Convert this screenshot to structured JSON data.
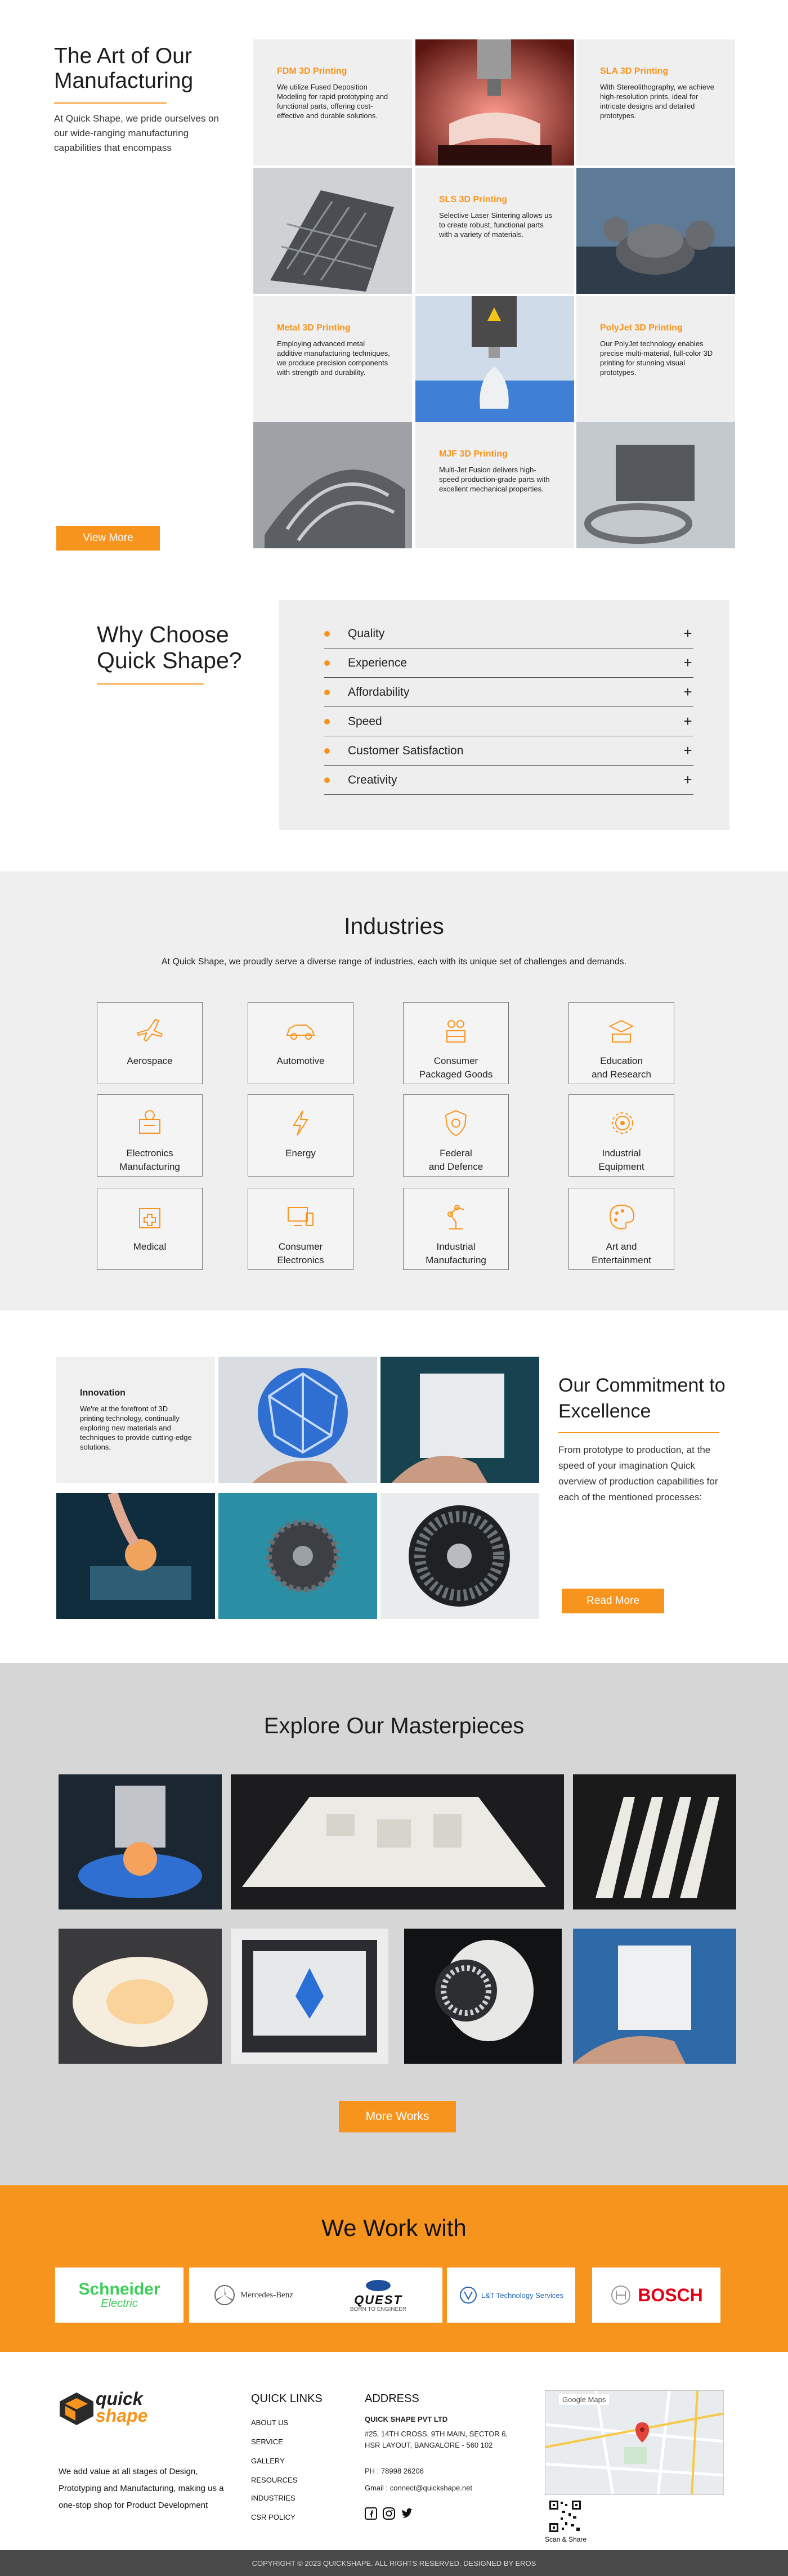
{
  "manufacturing": {
    "title": "The Art of Our Manufacturing",
    "description": "At Quick Shape, we pride ourselves on our wide-ranging manufacturing capabilities that encompass",
    "button": "View More",
    "tiles": [
      {
        "heading": "FDM 3D Printing",
        "text": "We utilize Fused Deposition Modeling for rapid prototyping and functional parts, offering cost-effective and durable solutions."
      },
      {
        "heading": "SLA 3D Printing",
        "text": "With Stereolithography, we achieve high-resolution prints, ideal for intricate designs and detailed prototypes."
      },
      {
        "heading": "SLS 3D Printing",
        "text": "Selective Laser Sintering allows us to create robust, functional parts with a variety of materials."
      },
      {
        "heading": "Metal 3D Printing",
        "text": "Employing advanced metal additive manufacturing techniques, we produce precision components with strength and durability."
      },
      {
        "heading": "PolyJet 3D Printing",
        "text": "Our PolyJet technology enables precise multi-material, full-color 3D printing for stunning visual prototypes."
      },
      {
        "heading": "MJF 3D Printing",
        "text": "Multi-Jet Fusion delivers high-speed production-grade parts with excellent mechanical properties."
      }
    ]
  },
  "why": {
    "title": "Why Choose Quick Shape?",
    "items": [
      "Quality",
      "Experience",
      "Affordability",
      "Speed",
      "Customer Satisfaction",
      "Creativity"
    ],
    "expand_symbol": "+"
  },
  "industries": {
    "title": "Industries",
    "subtitle": "At Quick Shape, we proudly serve a diverse range of industries, each with its unique set of challenges and demands.",
    "items": [
      {
        "label": "Aerospace",
        "icon": "airplane-icon"
      },
      {
        "label": "Automotive",
        "icon": "car-icon"
      },
      {
        "label": "Consumer\nPackaged Goods",
        "icon": "packaged-goods-icon"
      },
      {
        "label": "Education\nand Research",
        "icon": "education-icon"
      },
      {
        "label": "Electronics\nManufacturing",
        "icon": "electronics-icon"
      },
      {
        "label": "Energy",
        "icon": "energy-icon"
      },
      {
        "label": "Federal\nand Defence",
        "icon": "shield-icon"
      },
      {
        "label": "Industrial\nEquipment",
        "icon": "gear-icon"
      },
      {
        "label": "Medical",
        "icon": "medical-icon"
      },
      {
        "label": "Consumer\nElectronics",
        "icon": "devices-icon"
      },
      {
        "label": "Industrial\nManufacturing",
        "icon": "robot-arm-icon"
      },
      {
        "label": "Art and\nEntertainment",
        "icon": "palette-icon"
      }
    ]
  },
  "commitment": {
    "title": "Our Commitment to Excellence",
    "description": "From prototype to production, at the speed of your imagination Quick overview of production capabilities for each of the mentioned processes:",
    "button": "Read More",
    "tile_heading": "Innovation",
    "tile_text": "We're at the forefront of 3D printing technology, continually exploring new materials and techniques to provide cutting-edge solutions."
  },
  "masterpieces": {
    "title": "Explore Our Masterpieces",
    "button": "More Works"
  },
  "partners": {
    "title": "We Work with",
    "logos": [
      {
        "name": "Schneider",
        "sub": "Electric"
      },
      {
        "name": "Mercedes-Benz"
      },
      {
        "name": "QUEST",
        "sub": "BORN TO ENGINEER"
      },
      {
        "name": "L&T Technology Services"
      },
      {
        "name": "BOSCH"
      }
    ]
  },
  "footer": {
    "logo_top": "quick",
    "logo_bottom": "shape",
    "tagline": "We add value at all stages of Design, Prototyping and Manufacturing, making us a one-stop shop for Product Development",
    "quick_links_title": "QUICK LINKS",
    "links": [
      "ABOUT US",
      "SERVICE",
      "GALLERY",
      "RESOURCES",
      "INDUSTRIES",
      "CSR POLICY"
    ],
    "address_title": "ADDRESS",
    "company": "QUICK SHAPE PVT LTD",
    "address": "#25, 14TH CROSS, 9TH MAIN, SECTOR 6, HSR LAYOUT, BANGALORE - 560 102",
    "phone": "PH : 78998 26206",
    "email": "Gmail : connect@quickshape.net",
    "map_label": "Google Maps",
    "qr_label": "Scan & Share",
    "copyright": "COPYRIGHT © 2023 QUICKSHAPE. ALL RIGHTS RESERVED. DESIGNED BY EROS"
  }
}
